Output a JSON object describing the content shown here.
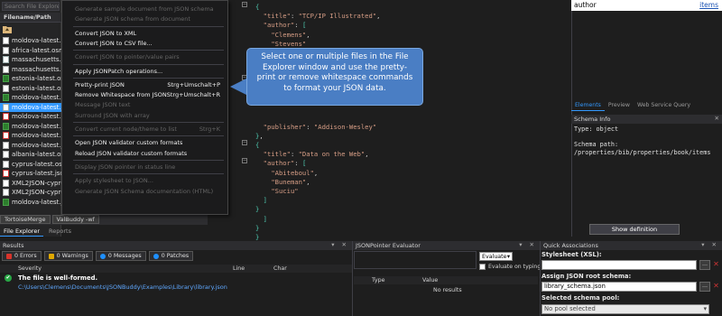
{
  "explorer": {
    "search_placeholder": "Search File Explorer",
    "header": "Filename/Path",
    "files": [
      {
        "name": "moldova-latest.osm",
        "kind": "osm"
      },
      {
        "name": "africa-latest.osm",
        "kind": "osm"
      },
      {
        "name": "massachusetts.json",
        "kind": "json"
      },
      {
        "name": "massachusetts.osm",
        "kind": "osm"
      },
      {
        "name": "estonia-latest.osm",
        "kind": "xml"
      },
      {
        "name": "estonia-latest.osm",
        "kind": "osm"
      },
      {
        "name": "moldova-latest.osm",
        "kind": "xml"
      },
      {
        "name": "moldova-latest.json",
        "kind": "json",
        "selected": true
      },
      {
        "name": "moldova-latest.osm",
        "kind": "xsd"
      },
      {
        "name": "moldova-latest.json",
        "kind": "xml"
      },
      {
        "name": "moldova-latest.osm",
        "kind": "xsd"
      },
      {
        "name": "moldova-latest.json",
        "kind": "osm"
      },
      {
        "name": "albania-latest.osm",
        "kind": "osm"
      },
      {
        "name": "cyprus-latest.osm",
        "kind": "osm"
      },
      {
        "name": "cyprus-latest.json",
        "kind": "xsd"
      },
      {
        "name": "XML2JSON-cyprus",
        "kind": "osm"
      },
      {
        "name": "XML2JSON-cyprus",
        "kind": "osm"
      },
      {
        "name": "moldova-latest.json",
        "kind": "xml"
      }
    ],
    "tool_tabs": [
      "TortoiseMerge",
      "ValBuddy -wf"
    ],
    "panel_tabs": [
      "File Explorer",
      "Reports"
    ]
  },
  "context_menu": {
    "items": [
      {
        "label": "Generate sample document from JSON schema",
        "disabled": true
      },
      {
        "label": "Generate JSON schema from document",
        "disabled": true
      },
      {
        "sep": true
      },
      {
        "label": "Convert JSON to XML",
        "disabled": false
      },
      {
        "label": "Convert JSON to CSV file...",
        "disabled": false
      },
      {
        "sep": true
      },
      {
        "label": "Convert JSON to pointer/value pairs",
        "disabled": true
      },
      {
        "sep": true
      },
      {
        "label": "Apply JSONPatch operations...",
        "disabled": false
      },
      {
        "sep": true
      },
      {
        "label": "Pretty-print JSON",
        "disabled": false,
        "shortcut": "Strg+Umschalt+P"
      },
      {
        "label": "Remove Whitespace from JSON",
        "disabled": false,
        "shortcut": "Strg+Umschalt+R"
      },
      {
        "label": "Message JSON text",
        "disabled": true
      },
      {
        "label": "Surround JSON with array",
        "disabled": true
      },
      {
        "sep": true
      },
      {
        "label": "Convert current node/theme to list",
        "disabled": true,
        "shortcut": "Strg+K"
      },
      {
        "sep": true
      },
      {
        "label": "Open JSON validator custom formats",
        "disabled": false
      },
      {
        "label": "Reload JSON validator custom formats",
        "disabled": false
      },
      {
        "sep": true
      },
      {
        "label": "Display JSON pointer in status line",
        "disabled": true
      },
      {
        "sep": true
      },
      {
        "label": "Apply stylesheet to JSON...",
        "disabled": true
      },
      {
        "label": "Generate JSON Schema documentation (HTML)",
        "disabled": true
      }
    ]
  },
  "editor": {
    "lines": [
      "{",
      "  \"title\": \"TCP/IP Illustrated\",",
      "  \"author\": [",
      "    \"Clemens\",",
      "    \"Stevens\"",
      "  ],",
      "  \"publisher\": \"Addison-Wesley\"",
      "},",
      "{",
      "",
      "",
      "",
      "",
      "  \"publisher\": \"Addison-Wesley\"",
      "},",
      "{",
      "  \"title\": \"Data on the Web\",",
      "  \"author\": [",
      "    \"Abiteboul\",",
      "    \"Buneman\",",
      "    \"Suciu\"",
      "  ]",
      "}",
      "  ]",
      "}",
      "}"
    ]
  },
  "callout": {
    "text": "Select one or multiple files in the File Explorer window and use the pretty-print or remove whitespace commands to format your JSON data."
  },
  "right_panel": {
    "node_name": "author",
    "items_link": "items",
    "tabs": [
      "Elements",
      "Preview",
      "Web Service Query"
    ],
    "schema_info_title": "Schema Info",
    "type_line": "Type: object",
    "schema_path_label": "Schema path:",
    "schema_path_value": "/properties/bib/properties/book/items",
    "show_definition": "Show definition"
  },
  "results": {
    "title": "Results",
    "filters": {
      "errors": "0 Errors",
      "warnings": "0 Warnings",
      "messages": "0 Messages",
      "patches": "0 Patches"
    },
    "columns": {
      "severity": "Severity",
      "line": "Line",
      "char": "Char"
    },
    "message": "The file is well-formed.",
    "path": "C:\\Users\\Clemens\\Documents\\JSONBuddy\\Examples\\Library\\library.json"
  },
  "jsonpointer": {
    "title": "JSONPointer Evaluator",
    "mode": "Evaluate",
    "evaluate_on_typing": "Evaluate on typing",
    "col_type": "Type",
    "col_value": "Value",
    "no_results": "No results"
  },
  "quick_associations": {
    "title": "Quick Associations",
    "stylesheet_label": "Stylesheet (XSL):",
    "stylesheet_value": "",
    "schema_label": "Assign JSON root schema:",
    "schema_value": "library_schema.json",
    "pool_label": "Selected schema pool:",
    "pool_value": "No pool selected"
  },
  "colors": {
    "accent": "#3399ff",
    "callout": "#4a7ec4",
    "ok": "#28a745",
    "error": "#d9342b",
    "warning": "#e0a800",
    "info": "#1e90ff"
  }
}
